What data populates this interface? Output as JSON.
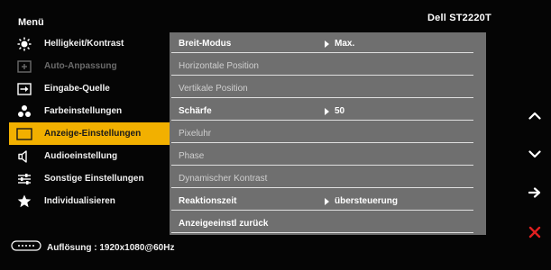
{
  "header": {
    "menu_title": "Menü",
    "model": "Dell ST2220T"
  },
  "menu": {
    "items": [
      {
        "label": "Helligkeit/Kontrast",
        "icon": "brightness-icon",
        "state": "normal"
      },
      {
        "label": "Auto-Anpassung",
        "icon": "auto-adjust-icon",
        "state": "disabled"
      },
      {
        "label": "Eingabe-Quelle",
        "icon": "input-source-icon",
        "state": "normal"
      },
      {
        "label": "Farbeinstellungen",
        "icon": "color-settings-icon",
        "state": "normal"
      },
      {
        "label": "Anzeige-Einstellungen",
        "icon": "display-settings-icon",
        "state": "selected"
      },
      {
        "label": "Audioeinstellung",
        "icon": "speaker-icon",
        "state": "normal"
      },
      {
        "label": "Sonstige Einstellungen",
        "icon": "sliders-icon",
        "state": "normal"
      },
      {
        "label": "Individualisieren",
        "icon": "star-icon",
        "state": "normal"
      }
    ]
  },
  "display_settings": {
    "rows": [
      {
        "label": "Breit-Modus",
        "value": "Max.",
        "state": "normal"
      },
      {
        "label": "Horizontale Position",
        "value": "",
        "state": "disabled"
      },
      {
        "label": "Vertikale Position",
        "value": "",
        "state": "disabled"
      },
      {
        "label": "Schärfe",
        "value": "50",
        "state": "normal"
      },
      {
        "label": "Pixeluhr",
        "value": "",
        "state": "disabled"
      },
      {
        "label": "Phase",
        "value": "",
        "state": "disabled"
      },
      {
        "label": "Dynamischer Kontrast",
        "value": "",
        "state": "disabled"
      },
      {
        "label": "Reaktionszeit",
        "value": "übersteuerung",
        "state": "normal"
      },
      {
        "label": "Anzeigeeinstl zurück",
        "value": "",
        "state": "normal"
      }
    ]
  },
  "status": {
    "resolution": "Auflösung : 1920x1080@60Hz",
    "icon": "connector-icon"
  },
  "buttons": [
    {
      "name": "up-arrow-icon",
      "glyph": "up"
    },
    {
      "name": "down-arrow-icon",
      "glyph": "down"
    },
    {
      "name": "right-arrow-icon",
      "glyph": "right"
    },
    {
      "name": "exit-x-icon",
      "glyph": "close"
    }
  ],
  "colors": {
    "selected": "#f2b000",
    "panel": "#6f6f6f",
    "exit": "#e02020",
    "background": "#050505"
  }
}
